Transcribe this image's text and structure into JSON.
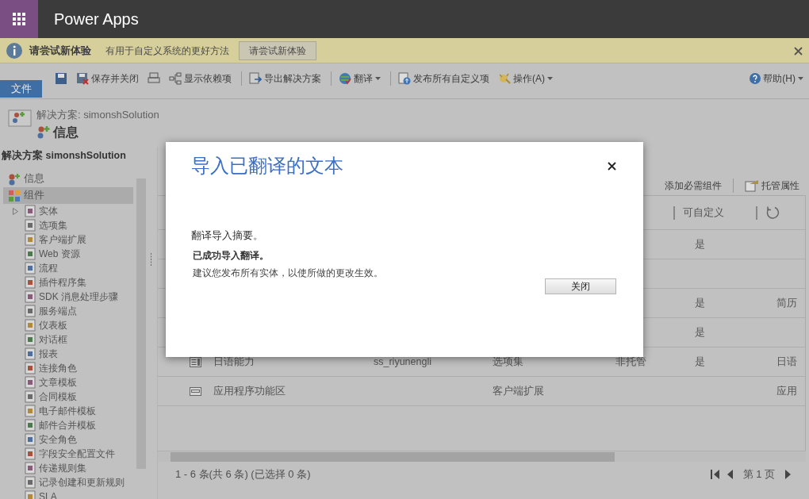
{
  "top_bar": {
    "title": "Power Apps"
  },
  "notification": {
    "title": "请尝试新体验",
    "message": "有用于自定义系统的更好方法",
    "button": "请尝试新体验"
  },
  "ribbon": {
    "file_tab": "文件",
    "commands": [
      {
        "kind": "save",
        "dropdown": false,
        "separator_before": false
      },
      {
        "kind": "save_close",
        "label": "保存并关闭",
        "dropdown": false,
        "separator_before": false
      },
      {
        "kind": "print",
        "dropdown": false,
        "separator_before": false
      },
      {
        "kind": "dependencies",
        "label": "显示依赖项",
        "dropdown": false,
        "separator_before": false
      },
      {
        "kind": "export",
        "label": "导出解决方案",
        "dropdown": false,
        "separator_before": true
      },
      {
        "kind": "translate",
        "label": "翻译",
        "dropdown": true,
        "separator_before": true
      },
      {
        "kind": "publish",
        "label": "发布所有自定义项",
        "dropdown": false,
        "separator_before": true
      },
      {
        "kind": "actions",
        "label": "操作(A)",
        "dropdown": true,
        "separator_before": false
      }
    ],
    "help": "帮助(H)"
  },
  "header": {
    "breadcrumb": "解决方案: simonshSolution",
    "title": "信息"
  },
  "nav": {
    "heading": "解决方案 simonshSolution",
    "items": [
      {
        "label": "信息",
        "selected": false
      },
      {
        "label": "组件",
        "selected": true,
        "children": [
          {
            "label": "实体",
            "expanded": false
          },
          {
            "label": "选项集"
          },
          {
            "label": "客户端扩展"
          },
          {
            "label": "Web 资源"
          },
          {
            "label": "流程"
          },
          {
            "label": "插件程序集"
          },
          {
            "label": "SDK 消息处理步骤"
          },
          {
            "label": "服务端点"
          },
          {
            "label": "仪表板"
          },
          {
            "label": "对话框"
          },
          {
            "label": "报表"
          },
          {
            "label": "连接角色"
          },
          {
            "label": "文章模板"
          },
          {
            "label": "合同模板"
          },
          {
            "label": "电子邮件模板"
          },
          {
            "label": "邮件合并模板"
          },
          {
            "label": "安全角色"
          },
          {
            "label": "字段安全配置文件"
          },
          {
            "label": "传递规则集"
          },
          {
            "label": "记录创建和更新规则"
          },
          {
            "label": "SLA"
          }
        ]
      }
    ]
  },
  "main": {
    "toolbar": [
      {
        "kind": "text",
        "label": "添加必需组件"
      },
      {
        "kind": "properties",
        "label": "托管属性"
      }
    ],
    "table": {
      "columns": [
        {
          "label": "可自定义"
        }
      ],
      "rows": [
        {
          "customizable": "是"
        },
        {},
        {
          "customizable": "是",
          "description": "简历"
        },
        {
          "customizable": "是"
        },
        {
          "kind": "optionset",
          "name": "日语能力",
          "schema": "ss_riyunengli",
          "type": "选项集",
          "managed": "非托管",
          "customizable": "是",
          "description": "日语"
        },
        {
          "kind": "ribbon",
          "name": "应用程序功能区",
          "type": "客户端扩展",
          "description": "应用"
        }
      ]
    },
    "footer": {
      "summary": "1 - 6  条(共 6 条) (已选择 0 条)",
      "page": "第 1 页"
    }
  },
  "dialog": {
    "title": "导入已翻译的文本",
    "summary": "翻译导入摘要。",
    "result": "已成功导入翻译。",
    "advice": "建议您发布所有实体，以使所做的更改生效。",
    "button": "关闭"
  }
}
